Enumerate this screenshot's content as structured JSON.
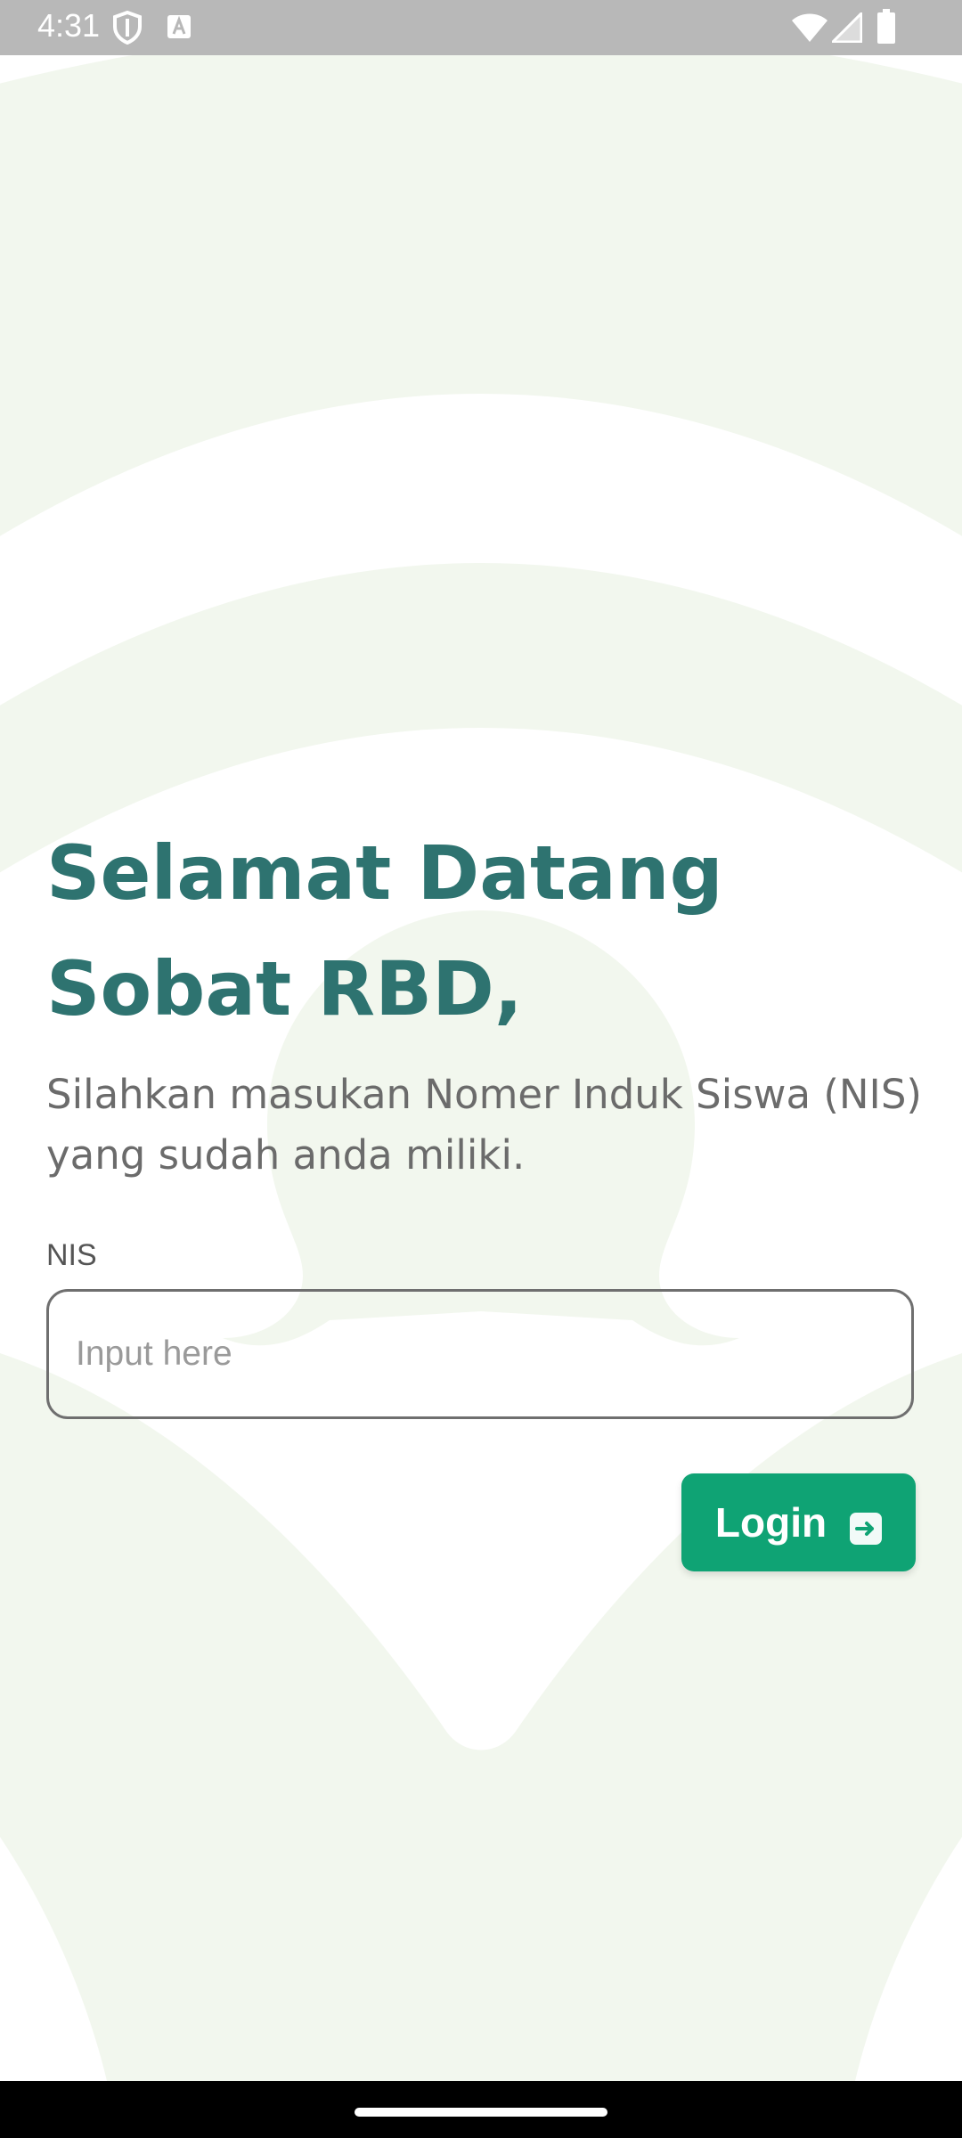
{
  "status_bar": {
    "time": "4:31",
    "left_icons": [
      "shield-icon",
      "a-letter-icon"
    ],
    "right_icons": [
      "wifi-icon",
      "signal-icon",
      "battery-icon"
    ]
  },
  "welcome": {
    "title": "Selamat Datang\nSobat RBD,",
    "subtitle": "Silahkan masukan Nomer Induk Siswa (NIS) yang sudah anda miliki."
  },
  "form": {
    "nis_label": "NIS",
    "nis_value": "",
    "nis_placeholder": "Input here",
    "login_label": "Login",
    "login_icon": "login-arrow-icon"
  },
  "colors": {
    "title": "#2e7370",
    "button": "#0fa374",
    "background_decoration": "#f2f7ee"
  }
}
